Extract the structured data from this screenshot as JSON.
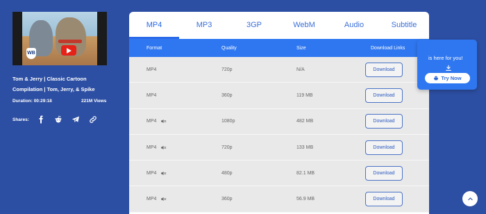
{
  "video": {
    "title": "Tom & Jerry | Classic Cartoon Compilation | Tom, Jerry, & Spike",
    "duration": "Duration: 00:29:18",
    "views": "221M Views",
    "thumbnail_logo": "WB"
  },
  "shares": {
    "label": "Shares:",
    "icons": [
      "facebook-icon",
      "reddit-icon",
      "telegram-icon",
      "link-icon"
    ]
  },
  "tabs": [
    {
      "label": "MP4",
      "active": true
    },
    {
      "label": "MP3",
      "active": false
    },
    {
      "label": "3GP",
      "active": false
    },
    {
      "label": "WebM",
      "active": false
    },
    {
      "label": "Audio",
      "active": false
    },
    {
      "label": "Subtitle",
      "active": false
    }
  ],
  "table": {
    "headers": {
      "format": "Format",
      "quality": "Quality",
      "size": "Size",
      "links": "Download Links"
    },
    "rows": [
      {
        "format": "MP4",
        "muted": false,
        "quality": "720p",
        "size": "N/A",
        "button": "Download"
      },
      {
        "format": "MP4",
        "muted": false,
        "quality": "360p",
        "size": "119 MB",
        "button": "Download"
      },
      {
        "format": "MP4",
        "muted": true,
        "quality": "1080p",
        "size": "482 MB",
        "button": "Download"
      },
      {
        "format": "MP4",
        "muted": true,
        "quality": "720p",
        "size": "133 MB",
        "button": "Download"
      },
      {
        "format": "MP4",
        "muted": true,
        "quality": "480p",
        "size": "82.1 MB",
        "button": "Download"
      },
      {
        "format": "MP4",
        "muted": true,
        "quality": "360p",
        "size": "56.9 MB",
        "button": "Download"
      }
    ]
  },
  "promo": {
    "text": "is here for you!",
    "button": "Try Now"
  },
  "colors": {
    "background": "#2d4fa3",
    "accent": "#2f77f0",
    "row_bg": "#e9e9e9"
  }
}
